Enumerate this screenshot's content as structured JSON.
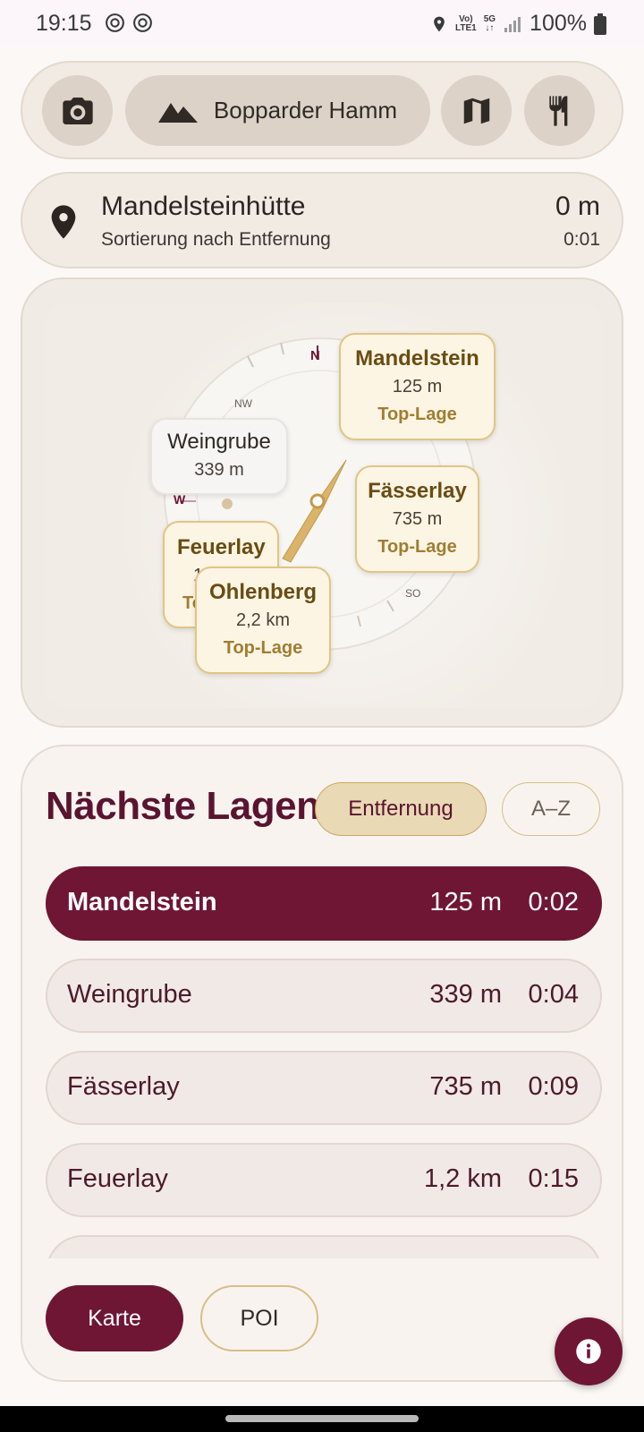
{
  "status_bar": {
    "time": "19:15",
    "network_volte": "Vo)",
    "network_lte": "LTE1",
    "network_5g": "5G",
    "battery": "100%",
    "icons": [
      "chatgpt-icon",
      "chatgpt-icon",
      "location-icon",
      "signal-icon",
      "battery-icon"
    ]
  },
  "toolbar": {
    "region_label": "Bopparder Hamm",
    "icons": [
      "camera-icon",
      "mountain-icon",
      "map-icon",
      "restaurant-icon"
    ]
  },
  "location": {
    "name": "Mandelsteinhütte",
    "subtitle": "Sortierung nach Entfernung",
    "distance": "0 m",
    "time": "0:01"
  },
  "compass": {
    "directions": {
      "n": "N",
      "nw": "NW",
      "w": "W",
      "so": "SO"
    },
    "markers": [
      {
        "name": "Mandelstein",
        "distance": "125 m",
        "badge": "Top-Lage"
      },
      {
        "name": "Weingrube",
        "distance": "339 m"
      },
      {
        "name": "Fässerlay",
        "distance": "735 m",
        "badge": "Top-Lage"
      },
      {
        "name": "Feuerlay",
        "distance": "1",
        "badge": "To"
      },
      {
        "name": "Ohlenberg",
        "distance": "2,2 km",
        "badge": "Top-Lage"
      }
    ],
    "accent_color": "#d9b46a"
  },
  "list": {
    "title": "Nächste Lagen",
    "sort_options": {
      "active": "Entfernung",
      "inactive": "A–Z"
    },
    "rows": [
      {
        "name": "Mandelstein",
        "distance": "125 m",
        "time": "0:02"
      },
      {
        "name": "Weingrube",
        "distance": "339 m",
        "time": "0:04"
      },
      {
        "name": "Fässerlay",
        "distance": "735 m",
        "time": "0:09"
      },
      {
        "name": "Feuerlay",
        "distance": "1,2 km",
        "time": "0:15"
      }
    ],
    "buttons": {
      "map": "Karte",
      "poi": "POI"
    }
  },
  "colors": {
    "primary": "#6f1634",
    "accent_gold": "#d9b46a",
    "surface": "#f1ebe4"
  }
}
